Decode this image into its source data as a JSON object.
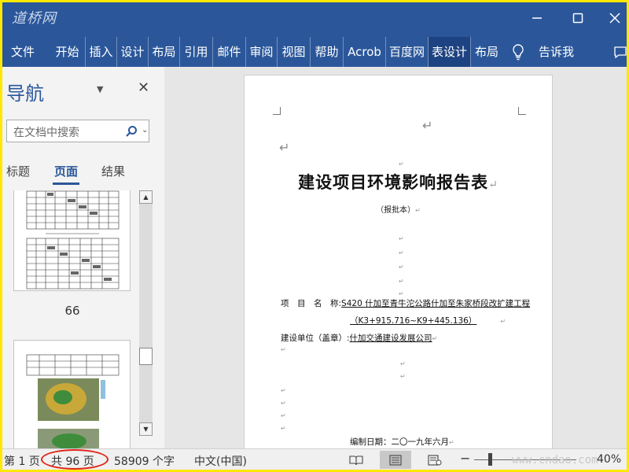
{
  "app": {
    "logo_text": "道桥网"
  },
  "ribbon": {
    "tabs": [
      "文件",
      "开始",
      "插入",
      "设计",
      "布局",
      "引用",
      "邮件",
      "审阅",
      "视图",
      "帮助",
      "Acrob",
      "百度网",
      "表设计",
      "布局"
    ],
    "tell_me": "告诉我"
  },
  "nav": {
    "title": "导航",
    "search_placeholder": "在文档中搜索",
    "tabs": [
      "标题",
      "页面",
      "结果"
    ],
    "active_tab": "页面",
    "thumb_label": "66"
  },
  "document": {
    "title": "建设项目环境影响报告表",
    "subtitle": "（报批本）",
    "project_label": "项　目　名　称:",
    "project_name": "S420 什加至青牛沱公路什加至朱家桥段改扩建工程",
    "project_range": "（K3+915.716~K9+445.136）",
    "unit_label": "建设单位（盖章）:",
    "unit_name": "什加交通建设发展公司",
    "date_label": "编制日期：二〇一九年六月",
    "para_mark": "↵",
    "small_mark": "↵"
  },
  "status": {
    "page": "第 1 页",
    "total": "共 96 页",
    "words": "58909 个字",
    "language": "中文(中国)",
    "zoom": "40%",
    "watermark": "www.cndao.com"
  },
  "colors": {
    "ribbon": "#2b579a",
    "ribbon_active": "#1e4382",
    "highlight_circle": "#e0261a",
    "outer_border": "#ffe800"
  }
}
